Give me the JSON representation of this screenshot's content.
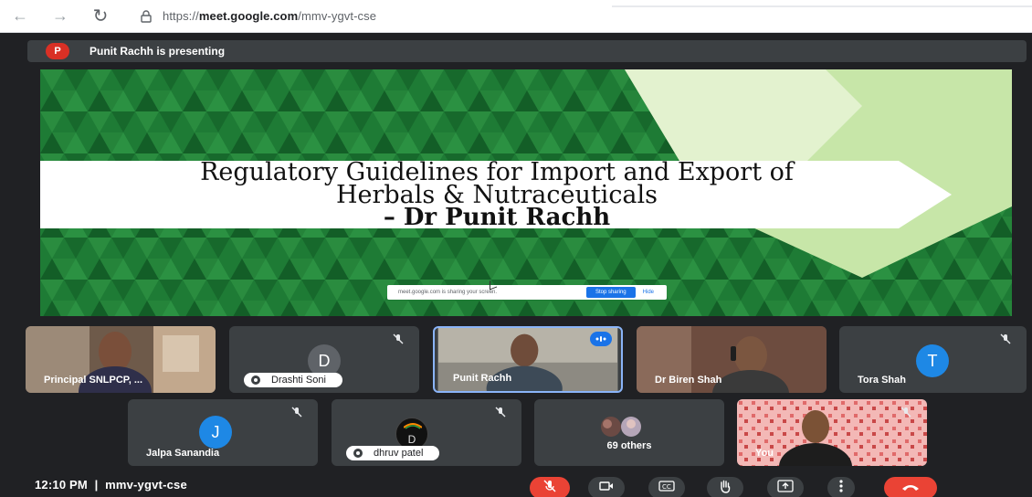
{
  "browser": {
    "url_scheme": "https://",
    "url_host": "meet.google.com",
    "url_path": "/mmv-ygvt-cse"
  },
  "presenting": {
    "avatar_letter": "P",
    "text": "Punit Rachh is presenting"
  },
  "slide": {
    "title_line1": "Regulatory Guidelines for Import and Export of",
    "title_line2": "Herbals & Nutraceuticals",
    "title_line3": "– Dr Punit Rachh",
    "share_notice": "meet.google.com is sharing your screen.",
    "stop_sharing": "Stop sharing",
    "hide": "Hide"
  },
  "participants": [
    {
      "name": "Principal SNLPCP, ..."
    },
    {
      "name": "Drashti Soni",
      "initial": "D"
    },
    {
      "name": "Punit Rachh"
    },
    {
      "name": "Dr Biren Shah"
    },
    {
      "name": "Tora Shah",
      "initial": "T"
    },
    {
      "name": "Jalpa Sanandia",
      "initial": "J"
    },
    {
      "name": "dhruv patel",
      "initial": "D"
    },
    {
      "name": "69 others"
    },
    {
      "name": "You"
    }
  ],
  "footer": {
    "time": "12:10 PM",
    "separator": "|",
    "meeting_code": "mmv-ygvt-cse"
  },
  "colors": {
    "tile_bg": "#3c4043",
    "accent_blue": "#1a73e8",
    "avatar_blue": "#1e88e5",
    "end_call_red": "#ea4335",
    "slide_green": "#1e7b35"
  },
  "icons": {
    "back": "back-arrow-icon",
    "forward": "forward-arrow-icon",
    "reload": "reload-icon",
    "lock": "lock-icon",
    "mic_off": "mic-off-icon",
    "camera": "camera-icon",
    "captions": "captions-icon",
    "hand": "raise-hand-icon",
    "present": "present-screen-icon",
    "more": "more-options-icon",
    "end_call": "end-call-icon"
  }
}
